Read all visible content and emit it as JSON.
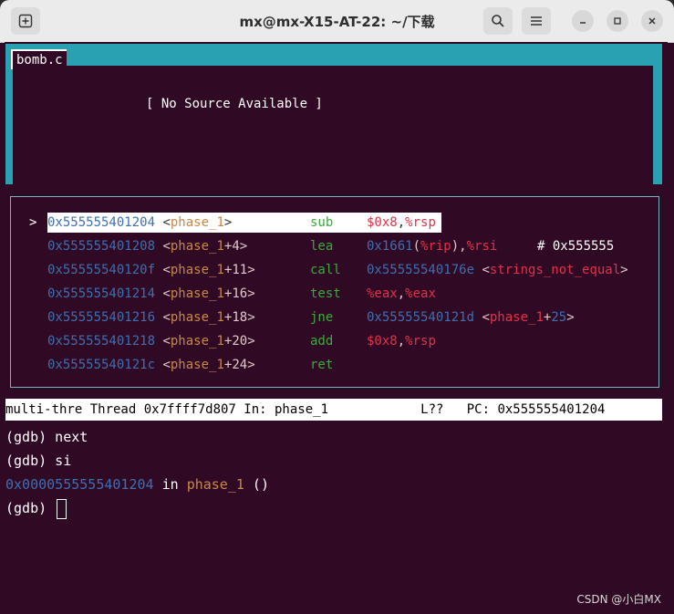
{
  "window": {
    "title": "mx@mx-X15-AT-22: ~/下载"
  },
  "source_pane": {
    "title": "bomb.c",
    "message": "[ No Source Available ]"
  },
  "asm": {
    "rows": [
      {
        "marker": ">",
        "addr": "0x555555401204",
        "sym_open": " <",
        "func": "phase_1",
        "offset": "",
        "sym_close": ">",
        "mnemonic": "sub",
        "op_a": "$0x8",
        "op_sep": ",",
        "op_b": "%rsp",
        "comment": "",
        "current": true
      },
      {
        "marker": "",
        "addr": "0x555555401208",
        "sym_open": " <",
        "func": "phase_1",
        "offset": "+4",
        "sym_close": ">",
        "mnemonic": "lea",
        "op_a": "0x1661(%rip)",
        "op_sep": ",",
        "op_b": "%rsi",
        "comment": "# 0x555555",
        "current": false
      },
      {
        "marker": "",
        "addr": "0x55555540120f",
        "sym_open": " <",
        "func": "phase_1",
        "offset": "+11",
        "sym_close": ">",
        "mnemonic": "call",
        "op_a": "0x55555540176e",
        "op_sep": " <",
        "op_b": "strings_not_equal",
        "comment": ">",
        "current": false
      },
      {
        "marker": "",
        "addr": "0x555555401214",
        "sym_open": " <",
        "func": "phase_1",
        "offset": "+16",
        "sym_close": ">",
        "mnemonic": "test",
        "op_a": "%eax",
        "op_sep": ",",
        "op_b": "%eax",
        "comment": "",
        "current": false
      },
      {
        "marker": "",
        "addr": "0x555555401216",
        "sym_open": " <",
        "func": "phase_1",
        "offset": "+18",
        "sym_close": ">",
        "mnemonic": "jne",
        "op_a": "0x55555540121d",
        "op_sep": " <",
        "op_b": "phase_1",
        "comment": "+25>",
        "current": false
      },
      {
        "marker": "",
        "addr": "0x555555401218",
        "sym_open": " <",
        "func": "phase_1",
        "offset": "+20",
        "sym_close": ">",
        "mnemonic": "add",
        "op_a": "$0x8",
        "op_sep": ",",
        "op_b": "%rsp",
        "comment": "",
        "current": false
      },
      {
        "marker": "",
        "addr": "0x55555540121c",
        "sym_open": " <",
        "func": "phase_1",
        "offset": "+24",
        "sym_close": ">",
        "mnemonic": "ret",
        "op_a": "",
        "op_sep": "",
        "op_b": "",
        "comment": "",
        "current": false
      }
    ]
  },
  "status_bar": {
    "text": "multi-thre Thread 0x7ffff7d807 In: phase_1            L??   PC: 0x555555401204"
  },
  "console": {
    "line1": "(gdb) next",
    "line2": "(gdb) si",
    "line3_addr": "0x0000555555401204",
    "line3_in": " in ",
    "line3_func": "phase_1",
    "line3_rest": " ()",
    "prompt": "(gdb) "
  },
  "watermark": "CSDN @小白MX",
  "colors": {
    "terminal_bg": "#300a24",
    "tui_border": "#2aa1b3",
    "address": "#3e6fb0",
    "register": "#e0324a",
    "mnemonic": "#3fa83f",
    "function": "#c8874b"
  }
}
